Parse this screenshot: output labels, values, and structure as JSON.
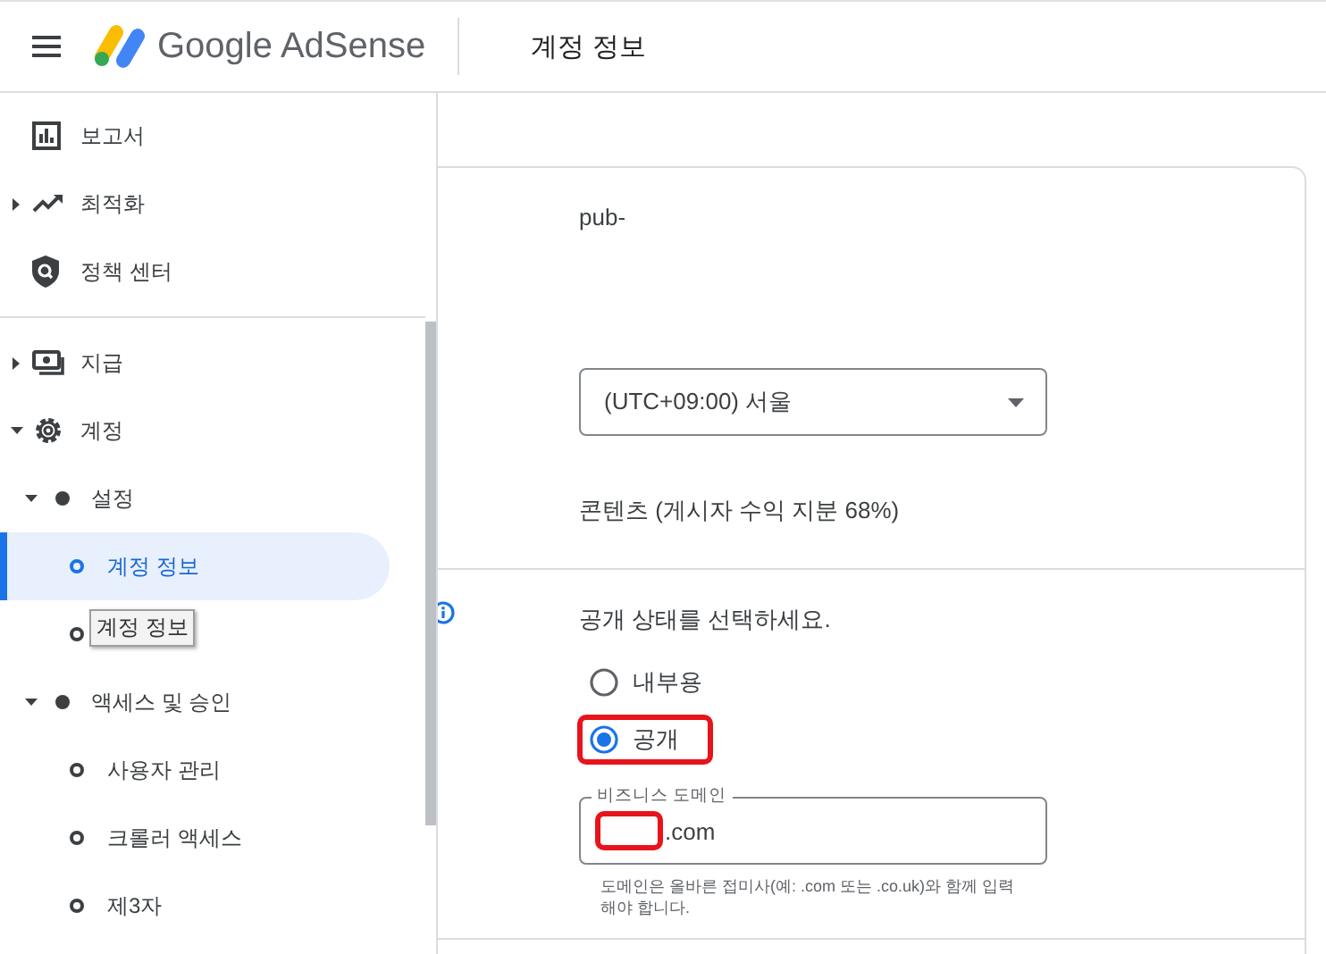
{
  "header": {
    "product": "Google AdSense",
    "page_title": "계정 정보"
  },
  "sidebar": {
    "items": [
      {
        "label": "보고서",
        "has_children": false,
        "divider_before": false
      },
      {
        "label": "최적화",
        "has_children": true,
        "expanded": false,
        "divider_before": false
      },
      {
        "label": "정책 센터",
        "has_children": false,
        "divider_before": false
      },
      {
        "label": "지급",
        "has_children": true,
        "expanded": false,
        "divider_before": true
      },
      {
        "label": "계정",
        "has_children": true,
        "expanded": true,
        "divider_before": false,
        "children": [
          {
            "label": "설정",
            "expanded": true,
            "children": [
              {
                "label": "계정 정보",
                "selected": true
              },
              {
                "tooltip": "계정 정보",
                "selected": false
              }
            ]
          },
          {
            "label": "액세스 및 승인",
            "expanded": true,
            "children": [
              {
                "label": "사용자 관리",
                "selected": false
              },
              {
                "label": "크롤러 액세스",
                "selected": false
              },
              {
                "label": "제3자",
                "selected": false
              }
            ]
          }
        ]
      }
    ]
  },
  "account": {
    "publisher_id": "pub-",
    "timezone": "(UTC+09:00) 서울",
    "product": "콘텐츠 (게시자 수익 지분 68%)"
  },
  "visibility": {
    "prompt": "공개 상태를 선택하세요.",
    "options": [
      {
        "label": "내부용",
        "selected": false,
        "highlighted": false
      },
      {
        "label": "공개",
        "selected": true,
        "highlighted": true
      }
    ],
    "domain": {
      "label": "비즈니스 도메인",
      "value": ".com",
      "highlighted": true
    },
    "hint": "도메인은 올바른 접미사(예: .com 또는 .co.uk)와 함께 입력해야 합니다."
  }
}
